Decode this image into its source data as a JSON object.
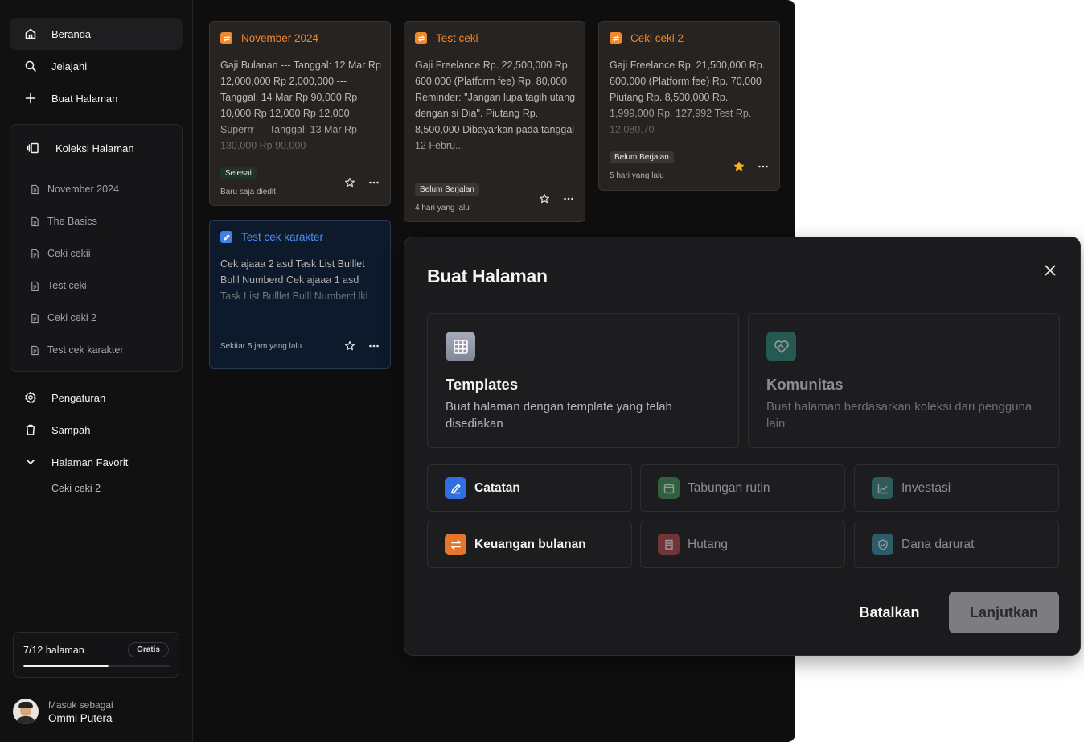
{
  "sidebar": {
    "nav": {
      "home": "Beranda",
      "explore": "Jelajahi",
      "create": "Buat Halaman"
    },
    "collection": {
      "title": "Koleksi Halaman",
      "items": [
        "November 2024",
        "The Basics",
        "Ceki cekii",
        "Test ceki",
        "Ceki ceki 2",
        "Test cek karakter"
      ]
    },
    "settings": "Pengaturan",
    "trash": "Sampah",
    "favorites": {
      "title": "Halaman Favorit",
      "items": [
        "Ceki ceki 2"
      ]
    },
    "quota": {
      "label": "7/12 halaman",
      "plan": "Gratis",
      "used": 7,
      "total": 12
    },
    "user": {
      "signed_in_as": "Masuk sebagai",
      "name": "Ommi Putera"
    }
  },
  "cards": [
    {
      "title": "November 2024",
      "body": "Gaji Bulanan --- Tanggal: 12 Mar Rp 12,000,000 Rp 2,000,000 --- Tanggal: 14 Mar Rp 90,000 Rp 10,000 Rp 12,000 Rp 12,000 Superrr --- Tanggal: 13 Mar Rp 130,000 Rp 90,000",
      "status": "Selesai",
      "time": "Baru saja diedit",
      "favorite": false,
      "theme": "orange"
    },
    {
      "title": "Test ceki",
      "body": "Gaji Freelance Rp. 22,500,000 Rp. 600,000 (Platform fee) Rp. 80,000 Reminder: \"Jangan lupa tagih utang dengan si Dia\". Piutang Rp. 8,500,000 Dibayarkan pada tanggal 12 Febru...",
      "status": "Belum Berjalan",
      "time": "4 hari yang lalu",
      "favorite": false,
      "theme": "orange"
    },
    {
      "title": "Ceki ceki 2",
      "body": "Gaji Freelance Rp. 21,500,000 Rp. 600,000 (Platform fee) Rp. 70,000 Piutang Rp. 8,500,000 Rp. 1,999,000 Rp. 127,992 Test Rp. 12,080,70",
      "status": "Belum Berjalan",
      "time": "5 hari yang lalu",
      "favorite": true,
      "theme": "orange"
    },
    {
      "title": "Test cek karakter",
      "body": "Cek ajaaa 2 asd Task List Bulllet Bulll Numberd Cek ajaaa 1 asd Task List Bulllet Bulll Numberd lkl",
      "status": "",
      "time": "Sekitar 5 jam yang lalu",
      "favorite": false,
      "theme": "blue"
    }
  ],
  "modal": {
    "title": "Buat Halaman",
    "options": [
      {
        "title": "Templates",
        "desc": "Buat halaman dengan template yang telah disediakan",
        "icon": "grid-icon",
        "color": "#8f97a8"
      },
      {
        "title": "Komunitas",
        "desc": "Buat halaman berdasarkan koleksi dari pengguna lain",
        "icon": "handshake-heart-icon",
        "color": "#2f8a7a"
      }
    ],
    "templates": [
      {
        "label": "Catatan",
        "icon": "pen-icon",
        "color": "#2f6fe0"
      },
      {
        "label": "Tabungan rutin",
        "icon": "calendar-icon",
        "color": "#3f9a5a"
      },
      {
        "label": "Investasi",
        "icon": "chart-icon",
        "color": "#3a8f8a"
      },
      {
        "label": "Keuangan bulanan",
        "icon": "swap-icon",
        "color": "#e8762a"
      },
      {
        "label": "Hutang",
        "icon": "receipt-icon",
        "color": "#b84a4a"
      },
      {
        "label": "Dana darurat",
        "icon": "shield-icon",
        "color": "#3a8fa8"
      }
    ],
    "cancel": "Batalkan",
    "next": "Lanjutkan"
  }
}
